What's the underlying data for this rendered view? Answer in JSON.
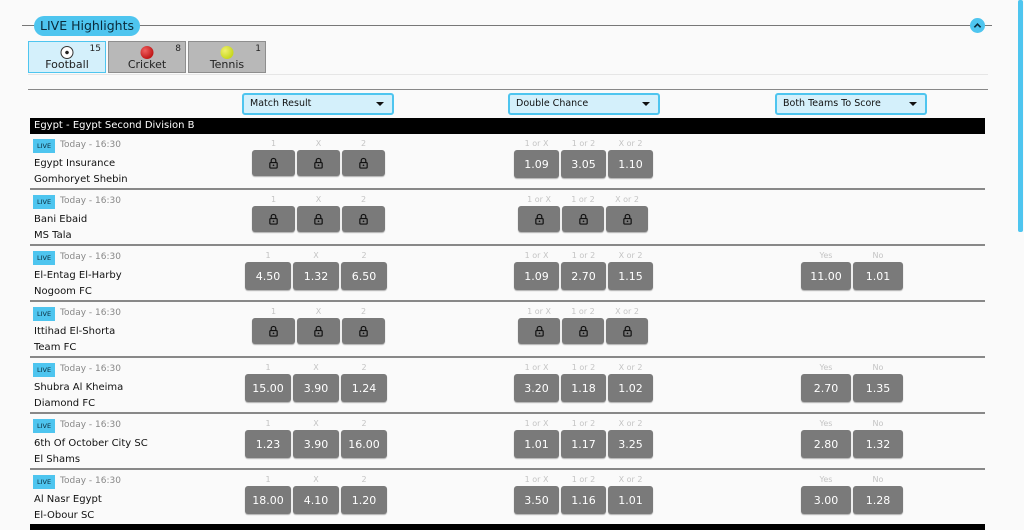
{
  "header": {
    "title": "LIVE Highlights",
    "collapse_icon": "chevron-up-icon"
  },
  "sport_tabs": [
    {
      "label": "Football",
      "count": "15",
      "icon": "football-icon",
      "active": true
    },
    {
      "label": "Cricket",
      "count": "8",
      "icon": "cricket-ball-icon",
      "active": false
    },
    {
      "label": "Tennis",
      "count": "1",
      "icon": "tennis-ball-icon",
      "active": false
    }
  ],
  "markets": [
    {
      "label": "Match Result",
      "outcomes": [
        "1",
        "X",
        "2"
      ]
    },
    {
      "label": "Double Chance",
      "outcomes": [
        "1 or X",
        "1 or 2",
        "X or 2"
      ]
    },
    {
      "label": "Both Teams To Score",
      "outcomes": [
        "Yes",
        "No"
      ]
    }
  ],
  "league": {
    "name": "Egypt - Egypt Second Division B"
  },
  "colors": {
    "accent": "#4ec5ef",
    "odds_button": "#7a7a7a",
    "league_bar": "#000000"
  },
  "matches": [
    {
      "live": "LIVE",
      "time": "Today - 16:30",
      "home": "Egypt Insurance",
      "away": "Gomhoryet Shebin",
      "match_result": {
        "locked": true,
        "odds": []
      },
      "double_chance": {
        "locked": false,
        "odds": [
          "1.09",
          "3.05",
          "1.10"
        ]
      },
      "btts": null
    },
    {
      "live": "LIVE",
      "time": "Today - 16:30",
      "home": "Bani Ebaid",
      "away": "MS Tala",
      "match_result": {
        "locked": true,
        "odds": []
      },
      "double_chance": {
        "locked": true,
        "odds": []
      },
      "btts": null
    },
    {
      "live": "LIVE",
      "time": "Today - 16:30",
      "home": "El-Entag El-Harby",
      "away": "Nogoom FC",
      "match_result": {
        "locked": false,
        "odds": [
          "4.50",
          "1.32",
          "6.50"
        ]
      },
      "double_chance": {
        "locked": false,
        "odds": [
          "1.09",
          "2.70",
          "1.15"
        ]
      },
      "btts": {
        "locked": false,
        "odds": [
          "11.00",
          "1.01"
        ]
      }
    },
    {
      "live": "LIVE",
      "time": "Today - 16:30",
      "home": "Ittihad El-Shorta",
      "away": "Team FC",
      "match_result": {
        "locked": true,
        "odds": []
      },
      "double_chance": {
        "locked": true,
        "odds": []
      },
      "btts": null
    },
    {
      "live": "LIVE",
      "time": "Today - 16:30",
      "home": "Shubra Al Kheima",
      "away": "Diamond FC",
      "match_result": {
        "locked": false,
        "odds": [
          "15.00",
          "3.90",
          "1.24"
        ]
      },
      "double_chance": {
        "locked": false,
        "odds": [
          "3.20",
          "1.18",
          "1.02"
        ]
      },
      "btts": {
        "locked": false,
        "odds": [
          "2.70",
          "1.35"
        ]
      }
    },
    {
      "live": "LIVE",
      "time": "Today - 16:30",
      "home": "6th Of October City SC",
      "away": "El Shams",
      "match_result": {
        "locked": false,
        "odds": [
          "1.23",
          "3.90",
          "16.00"
        ]
      },
      "double_chance": {
        "locked": false,
        "odds": [
          "1.01",
          "1.17",
          "3.25"
        ]
      },
      "btts": {
        "locked": false,
        "odds": [
          "2.80",
          "1.32"
        ]
      }
    },
    {
      "live": "LIVE",
      "time": "Today - 16:30",
      "home": "Al Nasr Egypt",
      "away": "El-Obour SC",
      "match_result": {
        "locked": false,
        "odds": [
          "18.00",
          "4.10",
          "1.20"
        ]
      },
      "double_chance": {
        "locked": false,
        "odds": [
          "3.50",
          "1.16",
          "1.01"
        ]
      },
      "btts": {
        "locked": false,
        "odds": [
          "3.00",
          "1.28"
        ]
      }
    }
  ]
}
